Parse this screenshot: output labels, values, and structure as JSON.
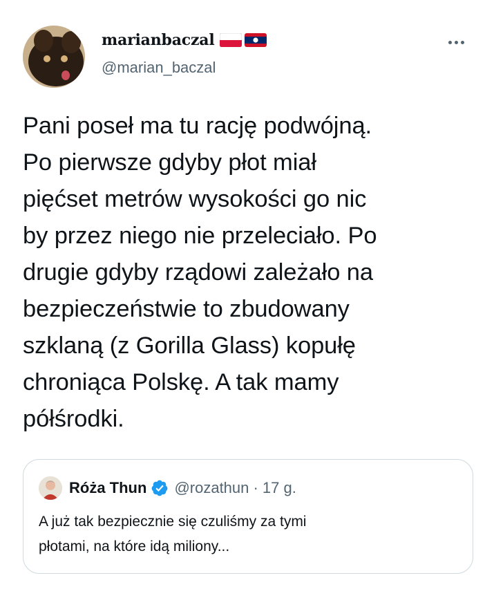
{
  "author": {
    "display_name": "marianbaczal",
    "handle": "@marian_baczal",
    "flags": [
      "poland-flag-icon",
      "laos-flag-icon"
    ]
  },
  "tweet": {
    "text": "Pani poseł ma tu rację podwójną.\nPo pierwsze gdyby płot miał\npięćset metrów wysokości go nic\nby przez niego nie przeleciało. Po\ndrugie gdyby rządowi zależało na\nbezpieczeństwie to zbudowany\nszklaną (z Gorilla Glass) kopułę\nchroniąca Polskę. A tak mamy\npółśrodki."
  },
  "quoted": {
    "display_name": "Róża Thun",
    "handle_time": "@rozathun · 17 g.",
    "text": "A już tak bezpiecznie się czuliśmy za tymi\npłotami, na które idą miliony..."
  },
  "colors": {
    "text": "#0f1419",
    "secondary": "#536471",
    "border": "#cfd9de",
    "verified": "#1d9bf0"
  }
}
